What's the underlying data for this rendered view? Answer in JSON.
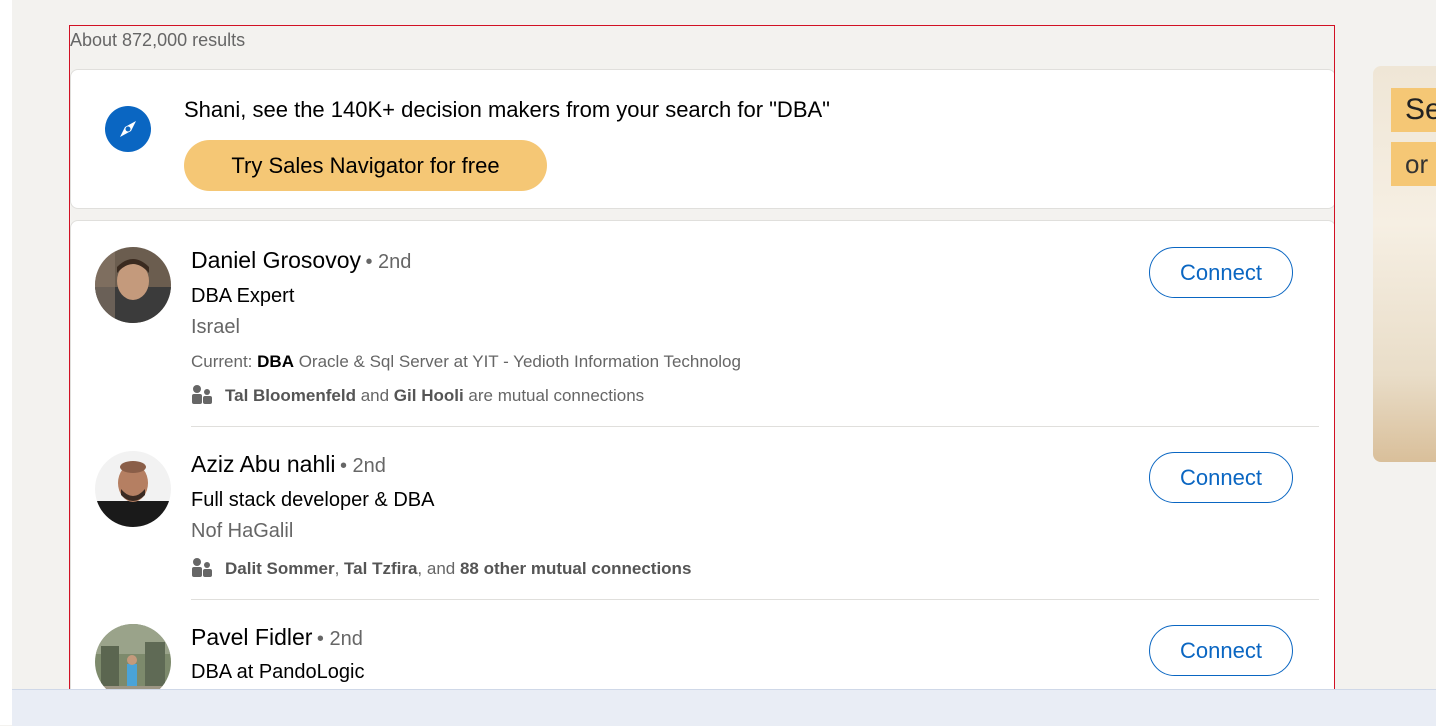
{
  "results": {
    "count_text": "About 872,000 results"
  },
  "promo": {
    "text": "Shani, see the 140K+ decision makers from your search for \"DBA\"",
    "button_label": "Try Sales Navigator for free",
    "icon": "compass-icon",
    "accent": "#f5c775"
  },
  "people": [
    {
      "name": "Daniel Grosovoy",
      "degree": "• 2nd",
      "headline": "DBA Expert",
      "location": "Israel",
      "current_prefix": "Current: ",
      "current_bold": "DBA",
      "current_rest": " Oracle & Sql Server at YIT - Yedioth Information Technolog",
      "mutual_a": "Tal Bloomenfeld",
      "mutual_and": " and ",
      "mutual_b": "Gil Hooli",
      "mutual_rest": " are mutual connections",
      "connect_label": "Connect"
    },
    {
      "name": "Aziz Abu nahli",
      "degree": "• 2nd",
      "headline": "Full stack developer & DBA",
      "location": "Nof HaGalil",
      "mutual_a": "Dalit Sommer",
      "mutual_sep": ", ",
      "mutual_b": "Tal Tzfira",
      "mutual_and": ", and ",
      "mutual_c": "88 other mutual connections",
      "connect_label": "Connect"
    },
    {
      "name": "Pavel Fidler",
      "degree": "• 2nd",
      "headline": "DBA at PandoLogic",
      "connect_label": "Connect"
    }
  ],
  "side_ad": {
    "title": "Se",
    "subtitle": "or"
  },
  "colors": {
    "link": "#0a66c2",
    "highlight_border": "#d11124",
    "background": "#f3f2ef"
  }
}
